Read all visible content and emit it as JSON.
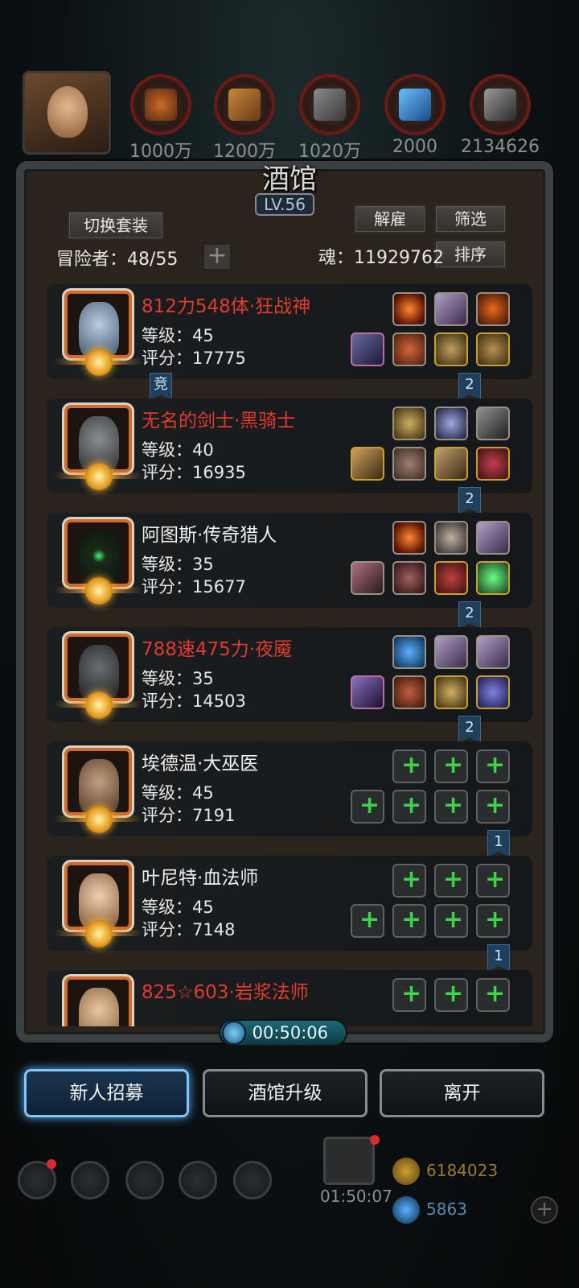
{
  "resources": [
    {
      "value": "1000万",
      "icon": "ore-icon"
    },
    {
      "value": "1200万",
      "icon": "wood-icon"
    },
    {
      "value": "1020万",
      "icon": "stone-icon"
    },
    {
      "value": "2000",
      "icon": "crystal-icon"
    },
    {
      "value": "2134626",
      "icon": "iron-icon"
    }
  ],
  "window": {
    "title": "酒馆",
    "level": "LV.56"
  },
  "toolbar": {
    "switch_outfit": "切换套装",
    "dismiss": "解雇",
    "filter": "筛选",
    "sort": "排序",
    "plus": "+"
  },
  "stats": {
    "adventurers_label": "冒险者：",
    "adventurers_value": "48/55",
    "soul_label": "魂：",
    "soul_value": "11929762"
  },
  "heroes": [
    {
      "name": "812力548体·狂战神",
      "level_label": "等级：",
      "level": "45",
      "score_label": "评分：",
      "score": "17775",
      "name_color": "red",
      "face": "#9fb7c9",
      "badge": "2",
      "badge_left": "竞"
    },
    {
      "name": "无名的剑士·黑骑士",
      "level_label": "等级：",
      "level": "40",
      "score_label": "评分：",
      "score": "16935",
      "name_color": "red",
      "face": "#6a6d70",
      "badge": "2"
    },
    {
      "name": "阿图斯·传奇猎人",
      "level_label": "等级：",
      "level": "35",
      "score_label": "评分：",
      "score": "15677",
      "name_color": "white",
      "face": "#2b3a2a",
      "badge": "2"
    },
    {
      "name": "788速475力·夜魇",
      "level_label": "等级：",
      "level": "35",
      "score_label": "评分：",
      "score": "14503",
      "name_color": "red",
      "face": "#5a5d60",
      "badge": "2"
    },
    {
      "name": "埃德温·大巫医",
      "level_label": "等级：",
      "level": "45",
      "score_label": "评分：",
      "score": "7191",
      "name_color": "white",
      "face": "#a0805a",
      "badge": "1"
    },
    {
      "name": "叶尼特·血法师",
      "level_label": "等级：",
      "level": "45",
      "score_label": "评分：",
      "score": "7148",
      "name_color": "white",
      "face": "#e0b890",
      "badge": "1"
    },
    {
      "name": "825☆603·岩浆法师",
      "level_label": "",
      "level": "",
      "score_label": "",
      "score": "",
      "name_color": "red",
      "face": "#d8b890",
      "badge": ""
    }
  ],
  "timer": "00:50:06",
  "actions": {
    "recruit": "新人招募",
    "upgrade": "酒馆升级",
    "leave": "离开"
  },
  "bottom": {
    "gift_timer": "01:50:07",
    "gold": "6184023",
    "gems": "5863"
  }
}
